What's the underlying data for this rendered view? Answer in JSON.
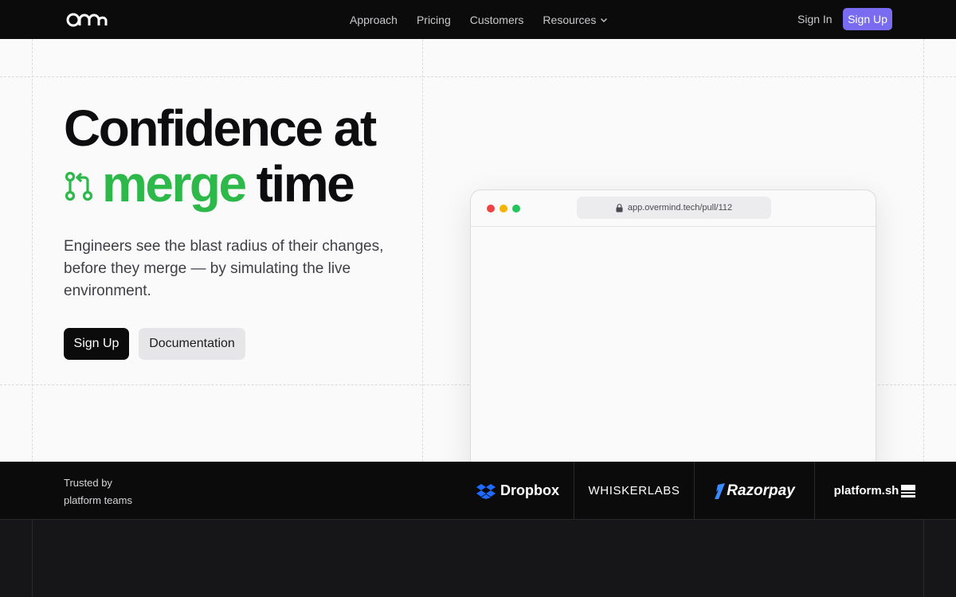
{
  "nav": {
    "logo_icon": "overmind-logo-icon",
    "links": [
      {
        "label": "Approach"
      },
      {
        "label": "Pricing"
      },
      {
        "label": "Customers"
      },
      {
        "label": "Resources"
      }
    ],
    "sign_in": "Sign In",
    "sign_up": "Sign Up"
  },
  "hero": {
    "title_line1": "Confidence at",
    "title_highlight": "merge",
    "title_end": "time",
    "subtitle": "Engineers see the blast radius of their changes, before they merge — by simulating the live environment.",
    "primary_cta": "Sign Up",
    "secondary_cta": "Documentation"
  },
  "browser": {
    "url": "app.overmind.tech/pull/112"
  },
  "trusted": {
    "label_line1": "Trusted by",
    "label_line2": "platform teams",
    "brands": [
      "Dropbox",
      "WHISKERLABS",
      "Razorpay",
      "platform.sh"
    ]
  },
  "colors": {
    "accent_green": "#2db84a",
    "signup_purple": "#7a6cf0",
    "dark": "#0b0b0c"
  }
}
